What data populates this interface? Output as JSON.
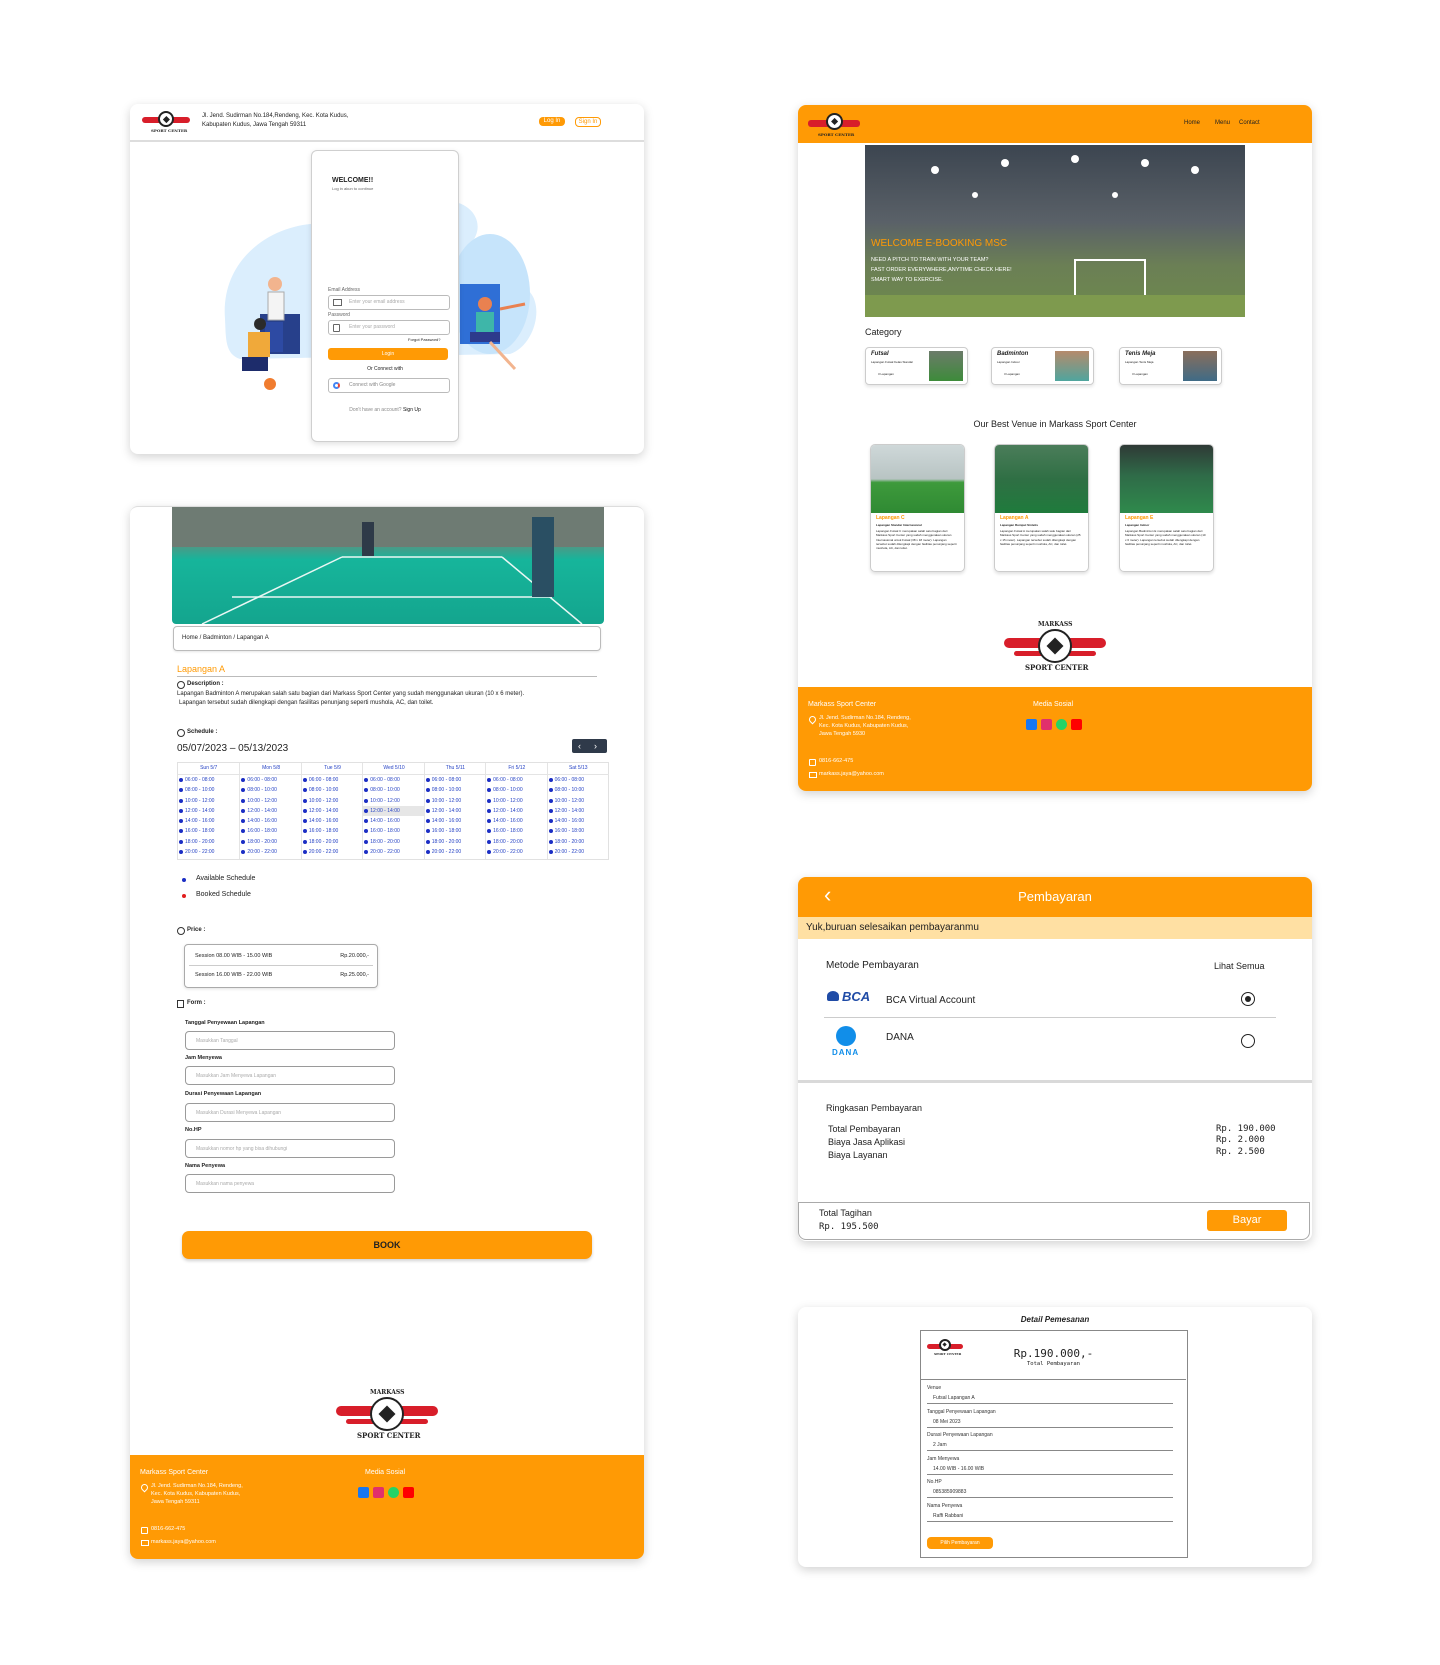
{
  "login": {
    "address": "Jl. Jend. Sudirman No.184,Rendeng, Kec. Kota Kudus, Kabupaten Kudus, Jawa Tengah 59311",
    "login_btn": "Log In",
    "signin_btn": "Sign In",
    "welcome": "WELCOME!!",
    "welcome_sub": "Log in akun to continue",
    "email_label": "Email Address",
    "email_placeholder": "Enter your email address",
    "password_label": "Password",
    "password_placeholder": "Enter your password",
    "forgot": "Forgot Password?",
    "submit": "Login",
    "or": "Or Connect with",
    "google": "Connect with Google",
    "no_account": "Don't have an account?",
    "signup": "Sign Up"
  },
  "logo": {
    "top_text": "MARKASS",
    "bottom_text": "SPORT CENTER"
  },
  "home": {
    "nav": [
      "Home",
      "Menu",
      "Contact"
    ],
    "hero_title": "WELCOME E-BOOKING MSC",
    "hero_line1": "NEED A PITCH TO TRAIN WITH YOUR TEAM?",
    "hero_line2": "FAST ORDER EVERYWHERE,ANYTIME CHECK HERE!",
    "hero_line3": "SMART WAY TO EXERCISE.",
    "category_heading": "Category",
    "categories": [
      {
        "name": "Futsal",
        "sub": "Lapangan Futsal Kelas Standar",
        "count": "3 Lapangan"
      },
      {
        "name": "Badminton",
        "sub": "Lapangan Indoor",
        "count": "3 Lapangan"
      },
      {
        "name": "Tenis Meja",
        "sub": "Lapangan Tenis Meja",
        "count": "3 Lapangan"
      }
    ],
    "venue_heading": "Our Best Venue in Markass Sport Center",
    "venues": [
      {
        "name": "Lapangan C",
        "sub": "Lapangan Standar Internasional",
        "desc": "Lapangan Futsal C merupakan salah satu bagian dari Markass Sport Center yang sudah menggunakan ukuran Internasional untuk Futsal (38 x 18 meter). Lapangan tersebut sudah dilengkapi dengan fasilitas penunjang seperti mushola, AC, dan toilet."
      },
      {
        "name": "Lapangan A",
        "sub": "Lapangan Rumput Sintetis",
        "desc": "Lapangan Futsal A merupakan salah satu bagian dari Markass Sport Center yang sudah menggunakan ukuran (25 x 15 meter). Lapangan tersebut sudah dilengkapi dengan fasilitas penunjang seperti mushola, AC, dan toilet."
      },
      {
        "name": "Lapangan E",
        "sub": "Lapangan Indoor",
        "desc": "Lapangan Badminton E merupakan salah satu bagian dari Markass Sport Center yang sudah menggunakan ukuran (10 x 6 meter). Lapangan tersebut sudah dilengkapi dengan fasilitas penunjang seperti mushola, AC, dan toilet."
      }
    ]
  },
  "footer": {
    "name": "Markass Sport Center",
    "address": "Jl. Jend. Sudirman No.184, Rendeng, Kec. Kota Kudus, Kabupaten Kudus, Jawa Tengah 5930",
    "address_b": "Jl. Jend. Sudirman No.184, Rendeng, Kec. Kota Kudus, Kabupaten Kudus, Jawa Tengah 59311",
    "phone": "0816-662-475",
    "email": "markass.jaya@yahoo.com",
    "media": "Media Sosial"
  },
  "detail": {
    "breadcrumb": "Home / Badminton / Lapangan A",
    "title": "Lapangan A",
    "desc_label": "Description :",
    "desc_line1": "Lapangan Badminton A merupakan salah satu bagian dari Markass Sport Center yang sudah menggunakan ukuran (10 x 6 meter).",
    "desc_line2": "Lapangan tersebut sudah dilengkapi dengan fasilitas penunjang seperti mushola, AC, dan toilet.",
    "schedule_label": "Schedule :",
    "date_range": "05/07/2023 – 05/13/2023",
    "days": [
      "Sun 5/7",
      "Mon 5/8",
      "Tue 5/9",
      "Wed 5/10",
      "Thu 5/11",
      "Fri 5/12",
      "Sat 5/13"
    ],
    "slots": [
      "06:00 - 08:00",
      "08:00 - 10:00",
      "10:00 - 12:00",
      "12:00 - 14:00",
      "14:00 - 16:00",
      "16:00 - 18:00",
      "18:00 - 20:00",
      "20:00 - 22:00"
    ],
    "legend_available": "Available Schedule",
    "legend_booked": "Booked Schedule",
    "price_label": "Price :",
    "prices": [
      {
        "session": "Session 08.00 WIB - 15.00 WIB",
        "price": "Rp.20.000,-"
      },
      {
        "session": "Session 16.00 WIB - 22.00 WIB",
        "price": "Rp.25.000,-"
      }
    ],
    "form_label": "Form :",
    "fields": [
      {
        "label": "Tanggal Penyewaan Lapangan",
        "placeholder": "Masukkan Tanggal"
      },
      {
        "label": "Jam Menyewa",
        "placeholder": "Masukkan Jam Menyewa Lapangan"
      },
      {
        "label": "Durasi Penyewaan Lapangan",
        "placeholder": "Masukkan Durasi Menyewa Lapangan"
      },
      {
        "label": "No.HP",
        "placeholder": "Masukkan nomor hp yang bisa dihubungi"
      },
      {
        "label": "Nama Penyewa",
        "placeholder": "Masukkan nama penyewa"
      }
    ],
    "book": "BOOK"
  },
  "payment": {
    "title": "Pembayaran",
    "banner": "Yuk,buruan selesaikan pembayaranmu",
    "method_label": "Metode Pembayaran",
    "see_all": "Lihat Semua",
    "bca_logo": "BCA",
    "bca": "BCA Virtual Account",
    "dana_logo": "DANA",
    "dana": "DANA",
    "summary_label": "Ringkasan Pembayaran",
    "items": [
      {
        "label": "Total Pembayaran",
        "value": "Rp. 190.000"
      },
      {
        "label": "Biaya Jasa Aplikasi",
        "value": "Rp. 2.000"
      },
      {
        "label": "Biaya Layanan",
        "value": "Rp. 2.500"
      }
    ],
    "total_label": "Total Tagihan",
    "total_value": "Rp. 195.500",
    "pay_btn": "Bayar"
  },
  "receipt": {
    "heading": "Detail Pemesanan",
    "amount": "Rp.190.000,-",
    "amount_label": "Total Pembayaran",
    "rows": [
      {
        "label": "Venue",
        "value": "Futsal Lapangan A"
      },
      {
        "label": "Tanggal Penyewaan Lapangan",
        "value": "08 Mei 2023"
      },
      {
        "label": "Durasi Penyewaan Lapangan",
        "value": "2 Jam"
      },
      {
        "label": "Jam Menyewa",
        "value": "14.00 WIB - 16.00 WIB"
      },
      {
        "label": "No.HP",
        "value": "085385909883"
      },
      {
        "label": "Nama Penyewa",
        "value": "Raffi Rabbani"
      }
    ],
    "button": "Pilih Pembayaran"
  },
  "colors": {
    "accent": "#ff9a05",
    "brand_red": "#d81e2a",
    "available": "#1b2ec4",
    "booked": "#e11d1d"
  }
}
